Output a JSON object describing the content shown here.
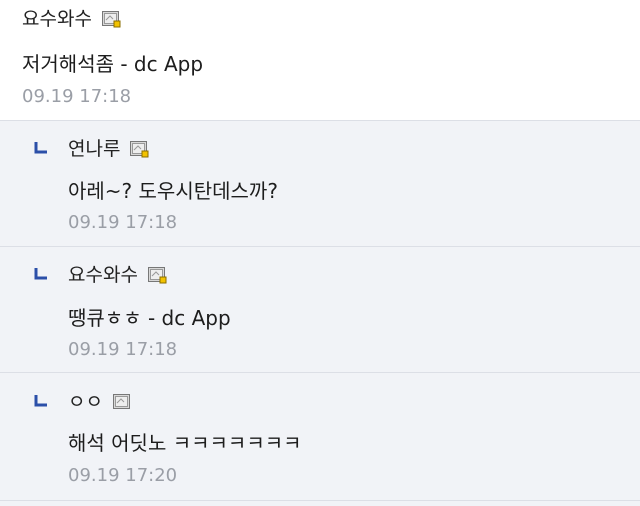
{
  "comments": [
    {
      "author": "요수와수",
      "content": "저거해석좀 - dc App",
      "time": "09.19 17:18",
      "icon": "gallog-icon-fixed"
    }
  ],
  "replies": [
    {
      "author": "연나루",
      "content": "아레~? 도우시탄데스까?",
      "time": "09.19 17:18",
      "icon": "gallog-icon-fixed"
    },
    {
      "author": "요수와수",
      "content": "땡큐ㅎㅎ - dc App",
      "time": "09.19 17:18",
      "icon": "gallog-icon-fixed"
    },
    {
      "author": "ㅇㅇ",
      "content": "해석 어딧노 ㅋㅋㅋㅋㅋㅋㅋ",
      "time": "09.19 17:20",
      "icon": "gallog-icon-fluid"
    }
  ],
  "colors": {
    "reply_arrow": "#2b4fa8",
    "time": "#9a9ea6",
    "reply_bg": "#f1f3f7",
    "main_bg": "#ffffff"
  }
}
